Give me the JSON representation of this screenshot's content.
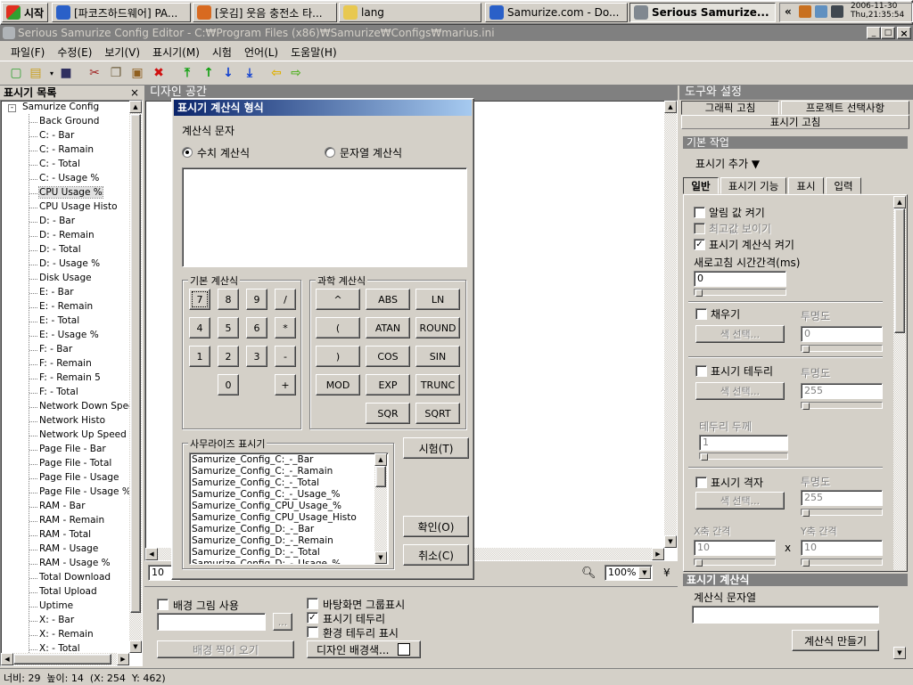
{
  "taskbar": {
    "start": "시작",
    "tasks": [
      "[파코즈하드웨어] PA...",
      "[웃김] 웃음 충전소 타...",
      "lang",
      "Samurize.com - Do...",
      "Serious Samurize..."
    ],
    "tray_chevron": "«",
    "date": "2006-11-30",
    "time": "Thu,21:35:54"
  },
  "window": {
    "title": "Serious Samurize Config Editor - C:₩Program Files (x86)₩Samurize₩Configs₩marius.ini",
    "min": "_",
    "max": "□",
    "close": "×"
  },
  "menu": [
    "파일(F)",
    "수정(E)",
    "보기(V)",
    "표시기(M)",
    "시험",
    "언어(L)",
    "도움말(H)"
  ],
  "left_panel": {
    "title": "표시기 목록",
    "close": "×",
    "root": "Samurize Config",
    "items": [
      "Back Ground",
      "C: - Bar",
      "C: - Ramain",
      "C: - Total",
      "C: - Usage %",
      "CPU Usage %",
      "CPU Usage Histo",
      "D: - Bar",
      "D: - Remain",
      "D: - Total",
      "D: - Usage %",
      "Disk Usage",
      "E: - Bar",
      "E: - Remain",
      "E: - Total",
      "E: - Usage %",
      "F: - Bar",
      "F: - Remain",
      "F: - Remain 5",
      "F: - Total",
      "Network Down Speed",
      "Network Histo",
      "Network Up Speed",
      "Page File - Bar",
      "Page File - Total",
      "Page File - Usage",
      "Page File - Usage %",
      "RAM - Bar",
      "RAM - Remain",
      "RAM - Total",
      "RAM - Usage",
      "RAM - Usage %",
      "Total Download",
      "Total Upload",
      "Uptime",
      "X: - Bar",
      "X: - Remain",
      "X: - Total"
    ]
  },
  "design": {
    "title": "디자인 공간",
    "zoom_field": "10",
    "zoom": "100%"
  },
  "dialog": {
    "title": "표시기 계산식 형식",
    "section": "계산식 문자",
    "radio_numeric": "수치 계산식",
    "radio_string": "문자열 계산식",
    "basic_group": "기본 계산식",
    "basic_keys": [
      "7",
      "8",
      "9",
      "/",
      "4",
      "5",
      "6",
      "*",
      "1",
      "2",
      "3",
      "-",
      "0",
      "+"
    ],
    "sci_group": "과학 계산식",
    "sci_keys": [
      "^",
      "ABS",
      "LN",
      "(",
      "ATAN",
      "ROUND",
      ")",
      "COS",
      "SIN",
      "MOD",
      "EXP",
      "TRUNC",
      "SQR",
      "SQRT"
    ],
    "meters_group": "사무라이즈 표시기",
    "meters": [
      "Samurize_Config_C:_-_Bar",
      "Samurize_Config_C:_-_Ramain",
      "Samurize_Config_C:_-_Total",
      "Samurize_Config_C:_-_Usage_%",
      "Samurize_Config_CPU_Usage_%",
      "Samurize_Config_CPU_Usage_Histo",
      "Samurize_Config_D:_-_Bar",
      "Samurize_Config_D:_-_Remain",
      "Samurize_Config_D:_-_Total",
      "Samurize_Config_D:_-_Usage_%"
    ],
    "test": "시험(T)",
    "ok": "확인(O)",
    "cancel": "취소(C)"
  },
  "bottom": {
    "bg_image": "배경 그림 사용",
    "browse": "...",
    "bg_capture": "배경 찍어 오기",
    "desk_group": "바탕화면 그룹표시",
    "meter_border": "표시기 테두리",
    "env_border": "환경 테두리 표시",
    "design_bg": "디자인 배경색..."
  },
  "right": {
    "title": "도구와 설정",
    "tabs": [
      "그래픽 고침",
      "프로젝트 선택사항"
    ],
    "subtab": "표시기 고침",
    "basic_work": "기본 작업",
    "add_meter": "표시기 추가 ▼",
    "inner_tabs": [
      "일반",
      "표시기 기능",
      "표시",
      "입력"
    ],
    "alarm": "알림 값 켜기",
    "max_show": "최고값 보이기",
    "calc_on": "표시기 계산식 켜기",
    "refresh": "새로고침 시간간격(ms)",
    "refresh_val": "0",
    "fill": "채우기",
    "transparency": "투명도",
    "color_select": "색 선택...",
    "fill_trans": "0",
    "border": "표시기 테두리",
    "border_trans": "255",
    "border_width": "테두리 두께",
    "border_width_val": "1",
    "grid": "표시기 격자",
    "grid_trans": "255",
    "x_gap": "X축 간격",
    "y_gap": "Y축 간격",
    "x_val": "10",
    "y_val": "10",
    "x_sep": "x",
    "calc_section": "표시기 계산식",
    "calc_string": "계산식 문자열",
    "make_calc": "계산식 만들기"
  },
  "status": "너비: 29  높이: 14  (X: 254  Y: 462)"
}
